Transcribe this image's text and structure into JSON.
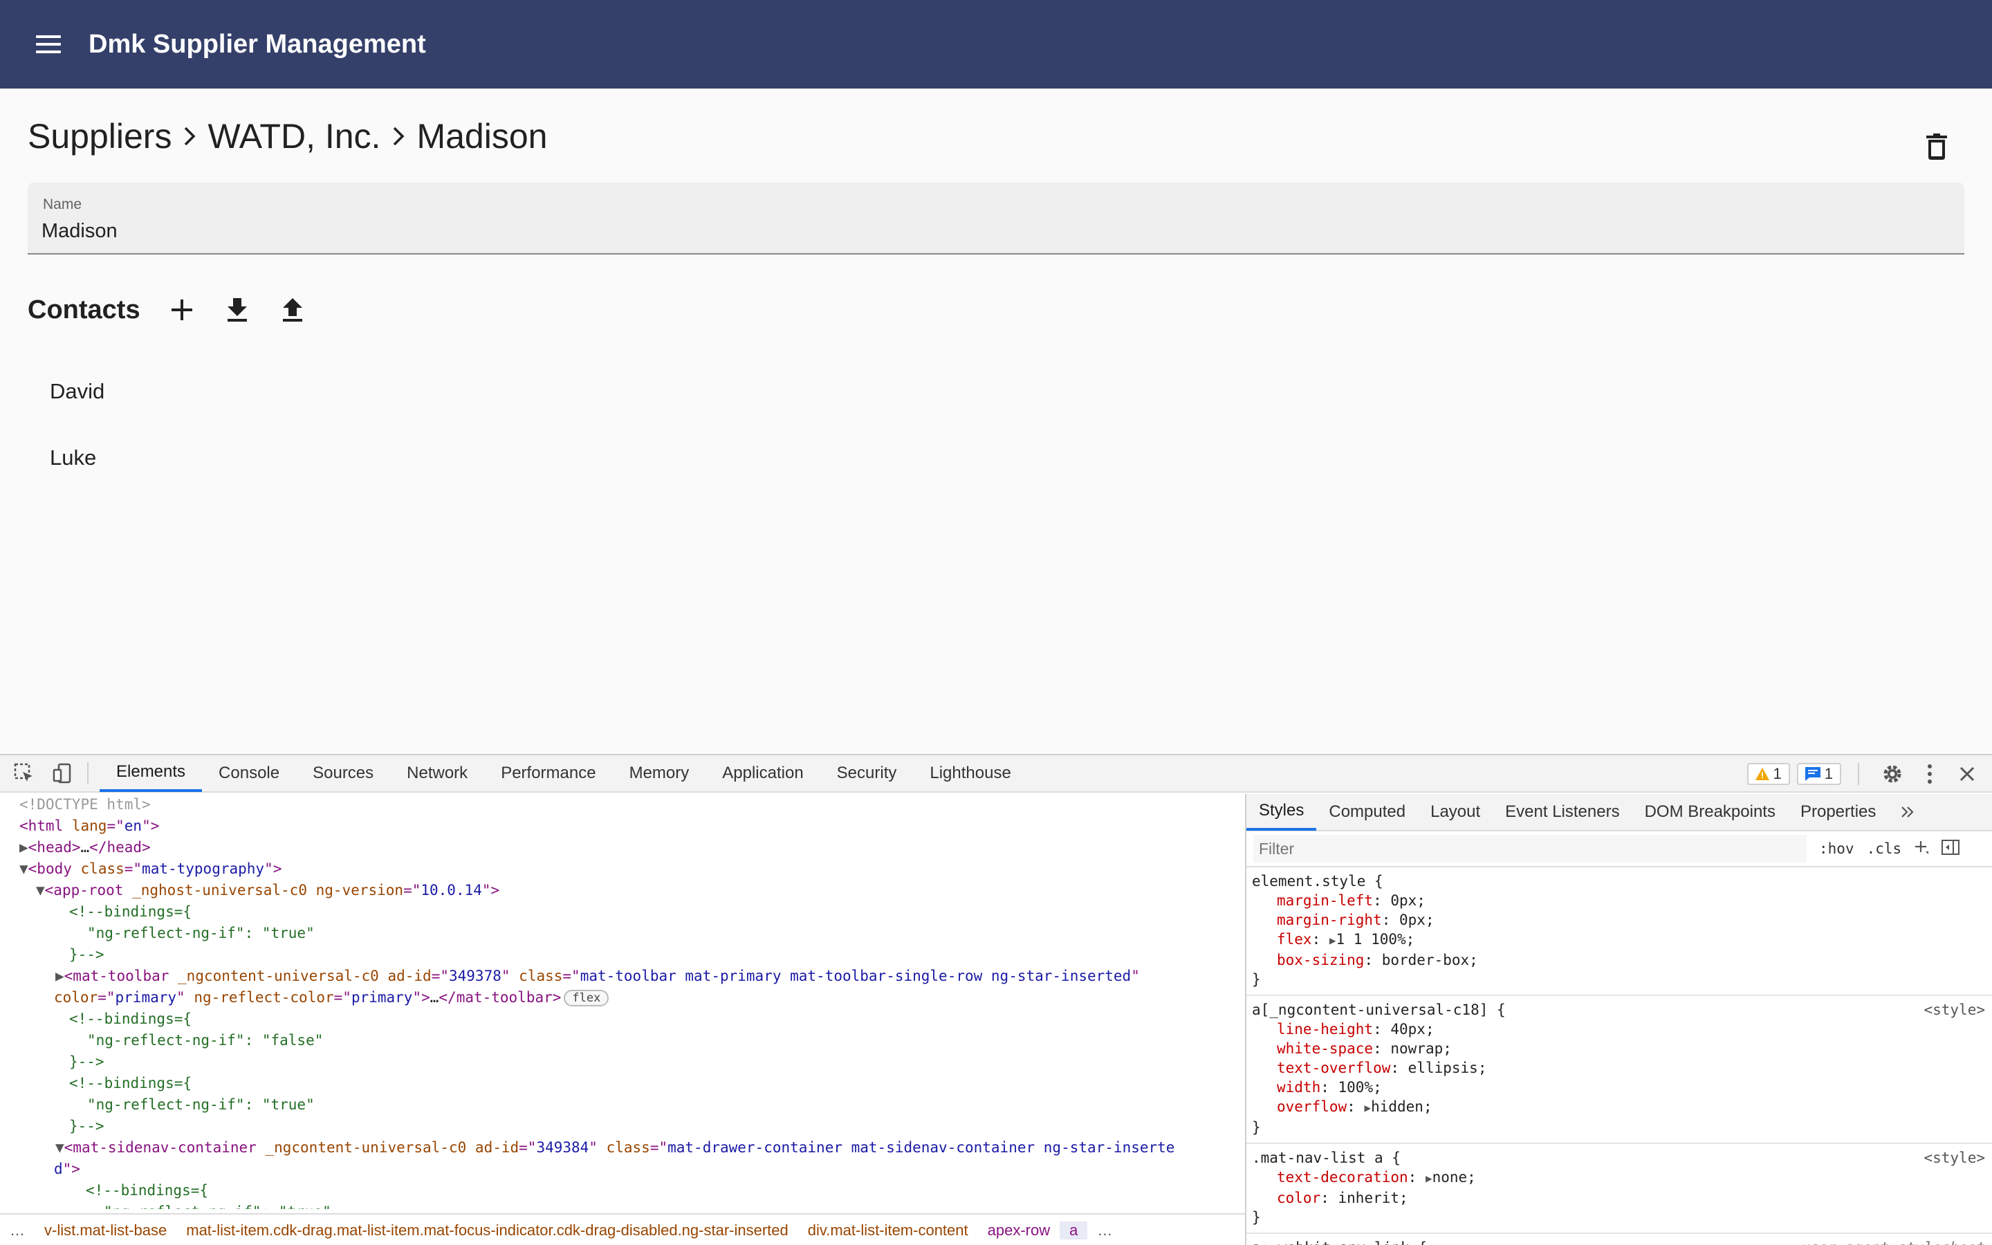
{
  "app": {
    "title": "Dmk Supplier Management",
    "menu_icon": "menu-icon",
    "toolbar_color": "#35406a"
  },
  "breadcrumb": [
    "Suppliers",
    "WATD, Inc.",
    "Madison"
  ],
  "form": {
    "name_label": "Name",
    "name_value": "Madison"
  },
  "contacts": {
    "title": "Contacts",
    "actions": [
      "add-icon",
      "download-icon",
      "upload-icon"
    ],
    "items": [
      "David",
      "Luke"
    ]
  },
  "devtools": {
    "tabs": [
      "Elements",
      "Console",
      "Sources",
      "Network",
      "Performance",
      "Memory",
      "Application",
      "Security",
      "Lighthouse"
    ],
    "active_tab": "Elements",
    "warnings": "1",
    "messages": "1",
    "elements": {
      "doctype": "<!DOCTYPE html>",
      "html_lang": "en",
      "head_collapsed": "…",
      "body_class": "mat-typography",
      "app_root_attr": "_nghost-universal-c0",
      "ng_version": "10.0.14",
      "binding_open": "<!--bindings={",
      "binding_true": "\"ng-reflect-ng-if\": \"true\"",
      "binding_false": "\"ng-reflect-ng-if\": \"false\"",
      "binding_close": "}-->",
      "toolbar_attr": "_ngcontent-universal-c0",
      "toolbar_ad_id": "349378",
      "toolbar_class": "mat-toolbar mat-primary mat-toolbar-single-row ng-star-inserted",
      "toolbar_color": "primary",
      "toolbar_reflect_color": "primary",
      "flex_badge": "flex",
      "sidenav_attr": "_ngcontent-universal-c0",
      "sidenav_ad_id": "349384",
      "sidenav_class_1": "mat-drawer-container mat-sidenav-container ng-star-inserte",
      "sidenav_class_2": "d",
      "partial_line": "\"ng-reflect-ng-if\": \"true\""
    },
    "crumbs": [
      "…",
      "v-list.mat-list-base",
      "mat-list-item.cdk-drag.mat-list-item.mat-focus-indicator.cdk-drag-disabled.ng-star-inserted",
      "div.mat-list-item-content",
      "apex-row",
      "a",
      "…"
    ],
    "styles": {
      "tabs": [
        "Styles",
        "Computed",
        "Layout",
        "Event Listeners",
        "DOM Breakpoints",
        "Properties"
      ],
      "active_tab": "Styles",
      "filter_placeholder": "Filter",
      "hov": ":hov",
      "cls": ".cls",
      "rules": [
        {
          "selector": "element.style {",
          "source": "",
          "decls": [
            {
              "p": "margin-left",
              "v": "0px;"
            },
            {
              "p": "margin-right",
              "v": "0px;"
            },
            {
              "p": "flex",
              "v": "1 1 100%;",
              "tri": true
            },
            {
              "p": "box-sizing",
              "v": "border-box;"
            }
          ]
        },
        {
          "selector": "a[_ngcontent-universal-c18] {",
          "source": "<style>",
          "decls": [
            {
              "p": "line-height",
              "v": "40px;"
            },
            {
              "p": "white-space",
              "v": "nowrap;"
            },
            {
              "p": "text-overflow",
              "v": "ellipsis;"
            },
            {
              "p": "width",
              "v": "100%;"
            },
            {
              "p": "overflow",
              "v": "hidden;",
              "tri": true
            }
          ]
        },
        {
          "selector": ".mat-nav-list a {",
          "source": "<style>",
          "decls": [
            {
              "p": "text-decoration",
              "v": "none;",
              "tri": true
            },
            {
              "p": "color",
              "v": "inherit;"
            }
          ]
        },
        {
          "selector": "a:-webkit-any-link {",
          "source": "user agent stylesheet",
          "decls": []
        }
      ]
    }
  }
}
